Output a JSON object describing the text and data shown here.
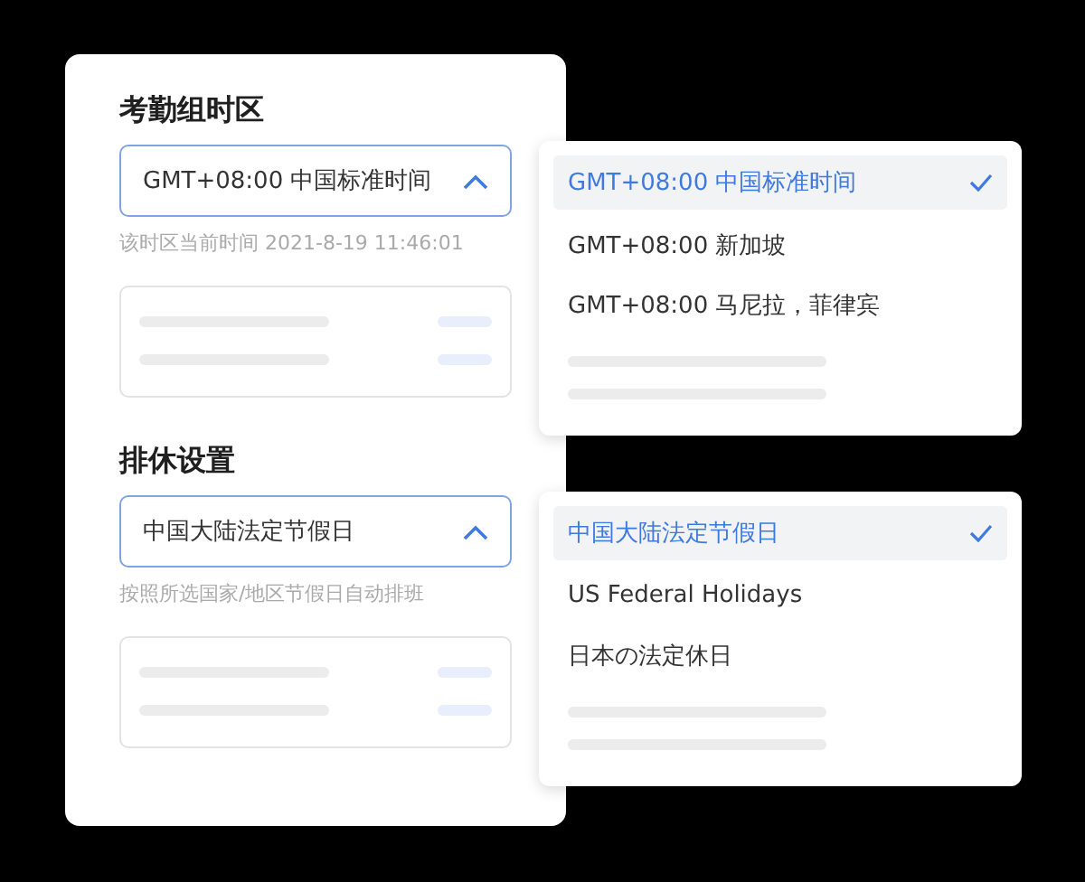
{
  "sections": [
    {
      "title": "考勤组时区",
      "select": {
        "value": "GMT+08:00 中国标准时间",
        "expanded": true
      },
      "hint": "该时区当前时间 2021-8-19 11:46:01",
      "options": [
        {
          "label": "GMT+08:00 中国标准时间",
          "selected": true
        },
        {
          "label": "GMT+08:00 新加坡",
          "selected": false
        },
        {
          "label": "GMT+08:00 马尼拉，菲律宾",
          "selected": false
        }
      ]
    },
    {
      "title": "排休设置",
      "select": {
        "value": "中国大陆法定节假日",
        "expanded": true
      },
      "hint": "按照所选国家/地区节假日自动排班",
      "options": [
        {
          "label": "中国大陆法定节假日",
          "selected": true
        },
        {
          "label": "US Federal Holidays",
          "selected": false
        },
        {
          "label": "日本の法定休日",
          "selected": false
        }
      ]
    }
  ]
}
